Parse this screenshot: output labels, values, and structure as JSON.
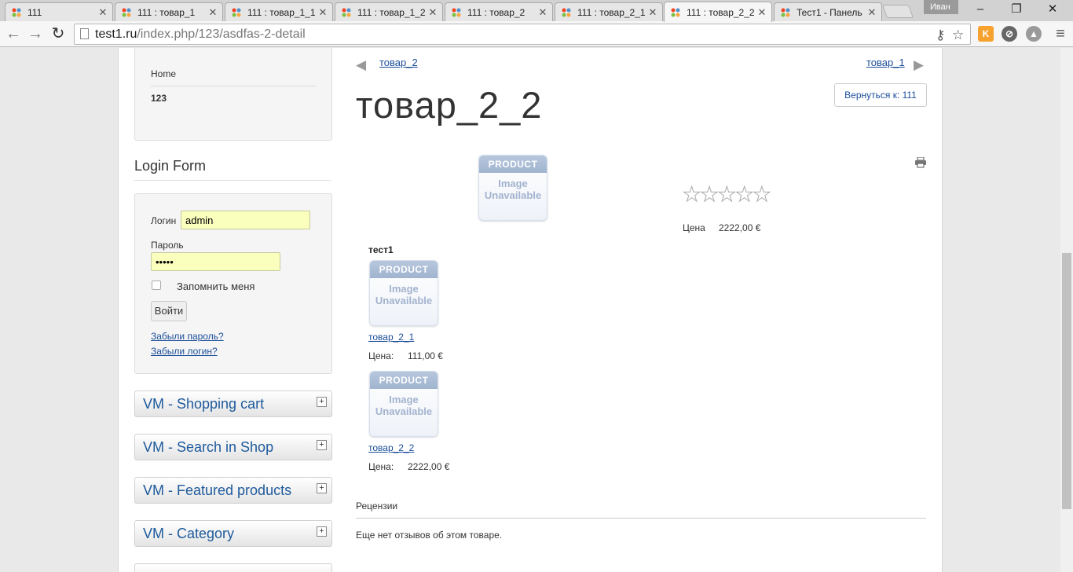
{
  "browser": {
    "tabs": [
      {
        "title": "111",
        "active": false
      },
      {
        "title": "111 : товар_1",
        "active": false
      },
      {
        "title": "111 : товар_1_1",
        "active": false
      },
      {
        "title": "111 : товар_1_2",
        "active": false
      },
      {
        "title": "111 : товар_2",
        "active": false
      },
      {
        "title": "111 : товар_2_1",
        "active": false
      },
      {
        "title": "111 : товар_2_2",
        "active": true
      },
      {
        "title": "Тест1 - Панель",
        "active": false
      }
    ],
    "user": "Иван",
    "url_host": "test1.ru",
    "url_path": "/index.php/123/asdfas-2-detail"
  },
  "sidebar": {
    "menu": [
      "Home",
      "123"
    ],
    "login_module_title": "Login Form",
    "login": {
      "username_label": "Логин",
      "username_value": "admin",
      "password_label": "Пароль",
      "password_value": "•••••",
      "remember_label": "Запомнить меня",
      "submit_label": "Войти",
      "forgot_password": "Забыли пароль?",
      "forgot_login": "Забыли логин?"
    },
    "vm_modules": [
      "VM - Shopping cart",
      "VM - Search in Shop",
      "VM - Featured products",
      "VM - Category"
    ]
  },
  "product": {
    "prev_link": "товар_2",
    "next_link": "товар_1",
    "title": "товар_2_2",
    "back_button": "Вернуться к: 111",
    "image_band": "PRODUCT",
    "image_text_1": "Image",
    "image_text_2": "Unavailable",
    "rating": 0,
    "rating_max": 5,
    "price_label": "Цена",
    "price_value": "2222,00 €"
  },
  "related": {
    "heading": "тест1",
    "items": [
      {
        "name": "товар_2_1",
        "price_label": "Цена:",
        "price": "111,00 €"
      },
      {
        "name": "товар_2_2",
        "price_label": "Цена:",
        "price": "2222,00 €"
      }
    ]
  },
  "reviews": {
    "heading": "Рецензии",
    "empty_text": "Еще нет отзывов об этом товаре."
  },
  "colors": {
    "link": "#1a4d99",
    "vm_title": "#1e5a9c",
    "autofill": "#faffbd"
  }
}
